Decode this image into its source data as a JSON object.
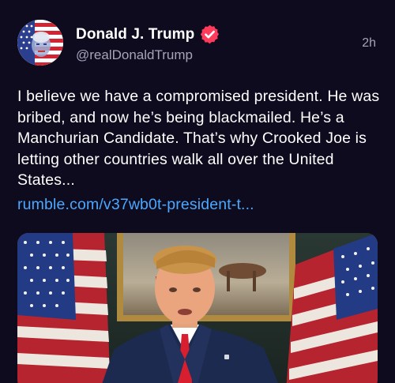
{
  "post": {
    "author": {
      "display_name": "Donald J. Trump",
      "handle": "@realDonaldTrump",
      "verified": true,
      "verified_color": "#ff3b5c"
    },
    "timestamp": "2h",
    "text": "I believe we have a compromised president. He was bribed, and now he’s being blackmailed. He’s a Manchurian Candidate. That’s why Crooked Joe is letting other countries walk all over the United States...",
    "link": "rumble.com/v37wb0t-president-t...",
    "link_color": "#4aa8ff",
    "media": {
      "type": "video-thumbnail",
      "icons": [
        "american-flag-left",
        "framed-painting",
        "speaker-at-podium",
        "american-flag-right"
      ]
    }
  }
}
